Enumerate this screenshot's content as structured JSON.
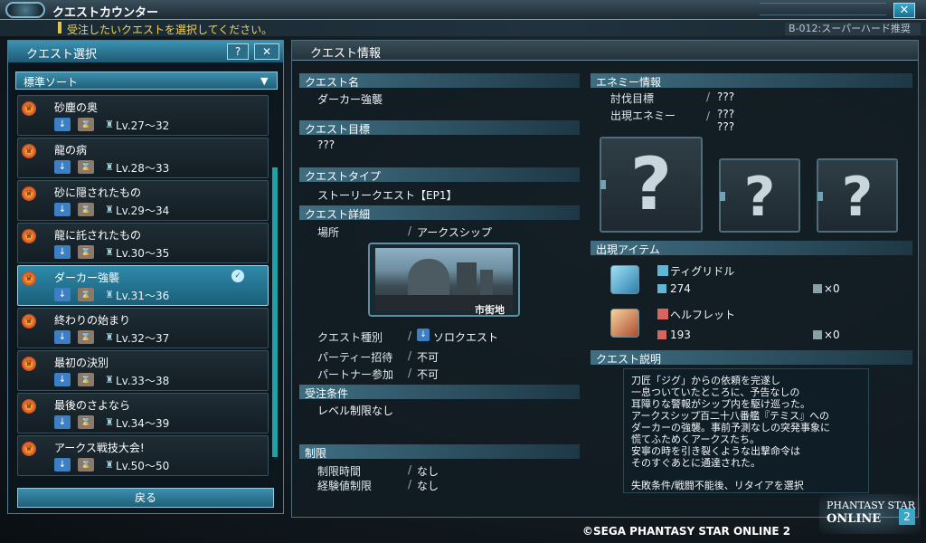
{
  "window": {
    "title": "クエストカウンター",
    "instruction": "受注したいクエストを選択してください。",
    "difficulty_tag": "B-012:スーパーハード推奨",
    "close_label": "✕"
  },
  "quest_select": {
    "title": "クエスト選択",
    "help_label": "?",
    "close_label": "✕",
    "sort_label": "標準ソート",
    "back_label": "戻る",
    "items": [
      {
        "name": "砂塵の奥",
        "level": "Lv.27〜32"
      },
      {
        "name": "龍の病",
        "level": "Lv.28〜33"
      },
      {
        "name": "砂に隠されたもの",
        "level": "Lv.29〜34"
      },
      {
        "name": "龍に託されたもの",
        "level": "Lv.30〜35"
      },
      {
        "name": "ダーカー強襲",
        "level": "Lv.31〜36",
        "selected": true
      },
      {
        "name": "終わりの始まり",
        "level": "Lv.32〜37"
      },
      {
        "name": "最初の決別",
        "level": "Lv.33〜38"
      },
      {
        "name": "最後のさよなら",
        "level": "Lv.34〜39"
      },
      {
        "name": "アークス戦技大会!",
        "level": "Lv.50〜50"
      }
    ]
  },
  "quest_info": {
    "title": "クエスト情報",
    "name_header": "クエスト名",
    "name": "ダーカー強襲",
    "goal_header": "クエスト目標",
    "goal": "???",
    "type_header": "クエストタイプ",
    "type": "ストーリークエスト【EP1】",
    "detail_header": "クエスト詳細",
    "place_label": "場所",
    "place_value": "アークスシップ",
    "area_caption": "市街地",
    "kind_label": "クエスト種別",
    "kind_value": "ソロクエスト",
    "party_label": "パーティー招待",
    "party_value": "不可",
    "partner_label": "パートナー参加",
    "partner_value": "不可",
    "cond_header": "受注条件",
    "cond_value": "レベル制限なし",
    "limit_header": "制限",
    "time_label": "制限時間",
    "time_value": "なし",
    "exp_label": "経験値制限",
    "exp_value": "なし",
    "separator": "/"
  },
  "enemy_info": {
    "header": "エネミー情報",
    "target_label": "討伐目標",
    "target_value": "???",
    "appear_label": "出現エネミー",
    "appear_value_1": "???",
    "appear_value_2": "???",
    "unknown_mark": "?"
  },
  "items_info": {
    "header": "出現アイテム",
    "items": [
      {
        "name": "ティグリドル",
        "number": "274",
        "count": "×0"
      },
      {
        "name": "ヘルフレット",
        "number": "193",
        "count": "×0"
      }
    ]
  },
  "description": {
    "header": "クエスト説明",
    "lines": [
      "刀匠「ジグ」からの依頼を完遂し",
      "一息ついていたところに、予告なしの",
      "耳障りな警報がシップ内を駆け巡った。",
      "アークスシップ百二十八番艦『テミス』への",
      "ダーカーの強襲。事前予測なしの突発事象に",
      "慌てふためくアークスたち。",
      "安寧の時を引き裂くような出撃命令は",
      "そのすぐあとに通達された。"
    ],
    "fail_condition": "失敗条件/戦闘不能後、リタイアを選択"
  },
  "footer": {
    "copyright": "©SEGA PHANTASY STAR ONLINE 2",
    "logo_line1": "PHANTASY STAR",
    "logo_line2": "ONLINE",
    "logo_num": "2"
  },
  "colors": {
    "accent": "#2e8aa9",
    "highlight_text": "#f2d25c",
    "panel_bg": "#121c22"
  }
}
